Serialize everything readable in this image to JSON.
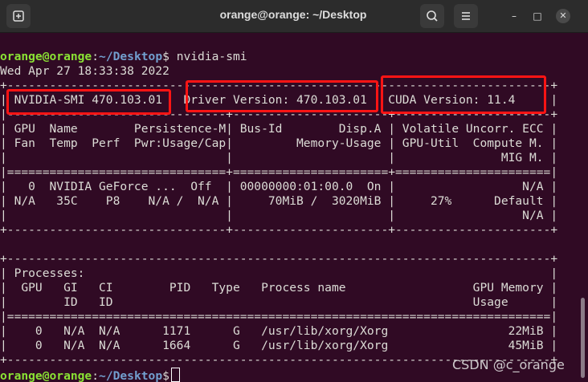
{
  "window": {
    "title": "orange@orange: ~/Desktop",
    "controls": {
      "new_tab": "⊞",
      "search": "🔍",
      "menu": "☰",
      "minimize": "–",
      "maximize": "□",
      "close": "✕"
    }
  },
  "terminal": {
    "prompt_user": "orange@orange",
    "prompt_sep": ":",
    "prompt_path": "~/Desktop",
    "prompt_symbol": "$",
    "command": "nvidia-smi",
    "lines": [
      "Wed Apr 27 18:33:38 2022",
      "+-----------------------------------------------------------------------------+",
      "| NVIDIA-SMI 470.103.01   Driver Version: 470.103.01   CUDA Version: 11.4     |",
      "|-------------------------------+----------------------+----------------------+",
      "| GPU  Name        Persistence-M| Bus-Id        Disp.A | Volatile Uncorr. ECC |",
      "| Fan  Temp  Perf  Pwr:Usage/Cap|         Memory-Usage | GPU-Util  Compute M. |",
      "|                               |                      |               MIG M. |",
      "|===============================+======================+======================|",
      "|   0  NVIDIA GeForce ...  Off  | 00000000:01:00.0  On |                  N/A |",
      "| N/A   35C    P8    N/A /  N/A |     70MiB /  3020MiB |     27%      Default |",
      "|                               |                      |                  N/A |",
      "+-------------------------------+----------------------+----------------------+",
      "",
      "+-----------------------------------------------------------------------------+",
      "| Processes:                                                                  |",
      "|  GPU   GI   CI        PID   Type   Process name                  GPU Memory |",
      "|        ID   ID                                                   Usage      |",
      "|=============================================================================|",
      "|    0   N/A  N/A      1171      G   /usr/lib/xorg/Xorg                 22MiB |",
      "|    0   N/A  N/A      1664      G   /usr/lib/xorg/Xorg                 45MiB |",
      "+-----------------------------------------------------------------------------+"
    ]
  },
  "watermark": "CSDN @c_orange"
}
